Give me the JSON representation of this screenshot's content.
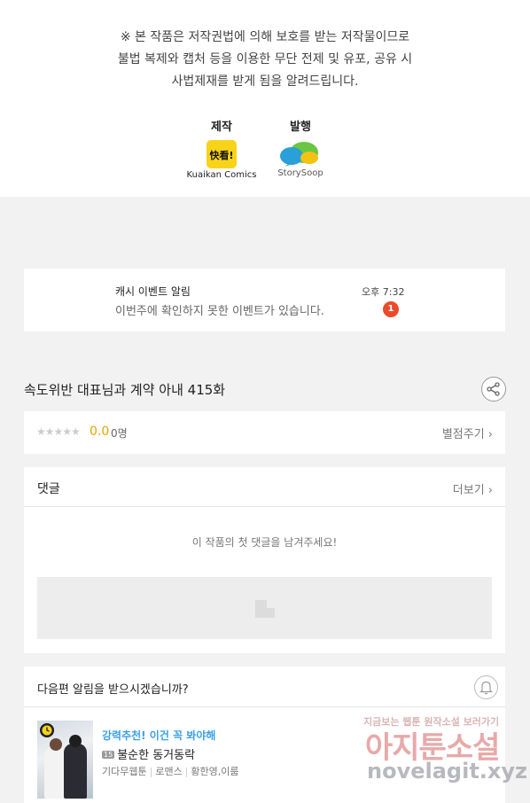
{
  "notice": {
    "line1": "※ 본 작품은 저작권법에 의해 보호를 받는 저작물이므로",
    "line2": "불법 복제와 캡처 등을 이용한 무단 전제 및 유포, 공유 시",
    "line3": "사법제재를 받게 됨을 알려드립니다."
  },
  "credits": {
    "producer_label": "제작",
    "producer_logo_text": "快看!",
    "producer_name": "Kuaikan Comics",
    "publisher_label": "발행",
    "publisher_name": "StorySoop"
  },
  "alert": {
    "title": "캐시 이벤트 알림",
    "message": "이번주에 확인하지 못한 이벤트가 있습니다.",
    "time": "오후 7:32",
    "badge_count": "1"
  },
  "episode": {
    "title": "속도위반 대표님과 계약 아내 415화"
  },
  "rating": {
    "stars": "★★★★★",
    "score": "0.0",
    "count": "0명",
    "rate_label": "별점주기 ›"
  },
  "comments": {
    "title": "댓글",
    "more_label": "더보기 ›",
    "empty_message": "이 작품의 첫 댓글을 남겨주세요!"
  },
  "next_alert": {
    "question": "다음편 알림을 받으시겠습니까?"
  },
  "recommendation": {
    "tag": "강력추천! 이건 꼭 봐야해",
    "age_badge": "15",
    "title": "불순한 동거동락",
    "meta": [
      "기다무웹툰",
      "로맨스",
      "황한영,이룸"
    ]
  },
  "watermark": {
    "small": "지금보는 웹툰 원작소설 보러가기",
    "big": "아지툰소설",
    "url": "novelagit.xyz"
  },
  "colors": {
    "accent_orange": "#e7a400",
    "badge_red": "#ea4a2b",
    "tag_blue": "#3ba0e5",
    "kuaikan_yellow": "#f7d31a"
  }
}
